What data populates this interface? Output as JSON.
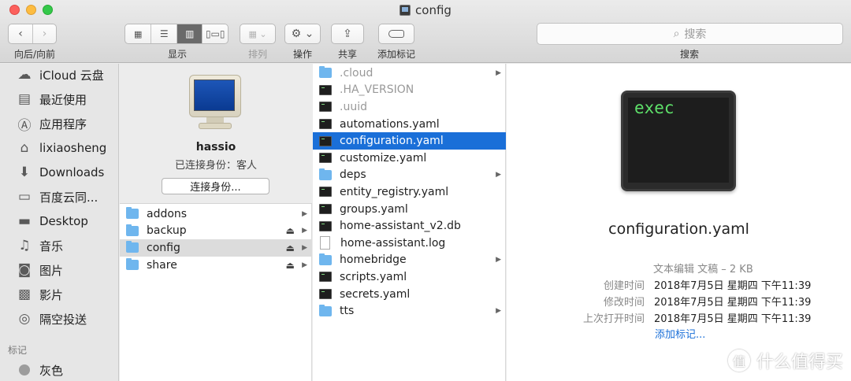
{
  "window": {
    "title": "config"
  },
  "toolbar": {
    "nav_label": "向后/向前",
    "view_label": "显示",
    "arrange_label": "排列",
    "action_label": "操作",
    "share_label": "共享",
    "tags_label": "添加标记",
    "search_label": "搜索",
    "search_placeholder": "搜索"
  },
  "sidebar": {
    "items": [
      {
        "label": "iCloud 云盘",
        "icon": "cloud-icon"
      },
      {
        "label": "最近使用",
        "icon": "recents-icon"
      },
      {
        "label": "应用程序",
        "icon": "applications-icon"
      },
      {
        "label": "lixiaosheng",
        "icon": "home-icon"
      },
      {
        "label": "Downloads",
        "icon": "downloads-icon"
      },
      {
        "label": "百度云同...",
        "icon": "folder-icon"
      },
      {
        "label": "Desktop",
        "icon": "desktop-icon"
      },
      {
        "label": "音乐",
        "icon": "music-icon"
      },
      {
        "label": "图片",
        "icon": "camera-icon"
      },
      {
        "label": "影片",
        "icon": "film-icon"
      },
      {
        "label": "隔空投送",
        "icon": "airdrop-icon"
      }
    ],
    "tags_header": "标记",
    "tags": [
      {
        "label": "灰色",
        "color": "#9c9c9c"
      }
    ]
  },
  "server": {
    "name": "hassio",
    "status": "已连接身份：客人",
    "connect_button": "连接身份..."
  },
  "shares": [
    {
      "name": "addons",
      "eject": false
    },
    {
      "name": "backup",
      "eject": true
    },
    {
      "name": "config",
      "eject": true
    },
    {
      "name": "share",
      "eject": true
    }
  ],
  "files": [
    {
      "name": ".cloud",
      "type": "folder"
    },
    {
      "name": ".HA_VERSION",
      "type": "terminal"
    },
    {
      "name": ".uuid",
      "type": "terminal"
    },
    {
      "name": "automations.yaml",
      "type": "terminal"
    },
    {
      "name": "configuration.yaml",
      "type": "terminal"
    },
    {
      "name": "customize.yaml",
      "type": "terminal"
    },
    {
      "name": "deps",
      "type": "folder"
    },
    {
      "name": "entity_registry.yaml",
      "type": "terminal"
    },
    {
      "name": "groups.yaml",
      "type": "terminal"
    },
    {
      "name": "home-assistant_v2.db",
      "type": "terminal"
    },
    {
      "name": "home-assistant.log",
      "type": "document"
    },
    {
      "name": "homebridge",
      "type": "folder"
    },
    {
      "name": "scripts.yaml",
      "type": "terminal"
    },
    {
      "name": "secrets.yaml",
      "type": "terminal"
    },
    {
      "name": "tts",
      "type": "folder"
    }
  ],
  "preview": {
    "icon_text": "exec",
    "file_name": "configuration.yaml",
    "kind": "文本编辑 文稿 – 2 KB",
    "meta": [
      {
        "key": "创建时间",
        "value": "2018年7月5日 星期四 下午11:39"
      },
      {
        "key": "修改时间",
        "value": "2018年7月5日 星期四 下午11:39"
      },
      {
        "key": "上次打开时间",
        "value": "2018年7月5日 星期四 下午11:39"
      }
    ],
    "add_tags": "添加标记..."
  },
  "watermark": {
    "text": "什么值得买",
    "mark": "值"
  },
  "colors": {
    "selection": "#1a6fd8",
    "folder": "#6fb6ee",
    "terminal_green": "#5ee06a"
  }
}
